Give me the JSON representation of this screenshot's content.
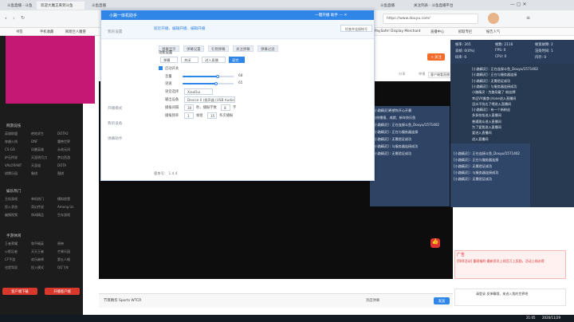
{
  "browser": {
    "tabs": [
      "斗鱼直播 - 斗鱼",
      "欢迎大魔王来到斗鱼",
      "斗鱼直播",
      "斗鱼直播",
      "关注列表 - 斗鱼直播平台"
    ],
    "url": "https://www.douyu.com/",
    "bookmarks": [
      "书签",
      "手机收藏",
      "网易巨人魔兽",
      "百度一下",
      "PaySafe! Display Merchant",
      "直播中心",
      "抓取专栏",
      "报告人气"
    ]
  },
  "leftside": {
    "section_games": "网游竞技",
    "games": [
      "英雄联盟",
      "绝地求生",
      "DOTA2",
      "穿越火线",
      "DNF",
      "魔兽世界",
      "CS:GO",
      "风暴英雄",
      "永劫无间",
      "炉石传说",
      "天涯明月刀",
      "梦幻西游",
      "VALORANT",
      "天涯道",
      "DOTA",
      "棋牌乐园",
      "象棋",
      "围棋"
    ],
    "section_casual": "娱乐热门",
    "casual": [
      "主机游戏",
      "单机热门",
      "模拟经营",
      "投入状态",
      "奇幻传说",
      "Among Us",
      "幽情视频",
      "休闲精品",
      "生存游戏"
    ],
    "section_mobile": "手游休闲",
    "mobile": [
      "王者荣耀",
      "和平精英",
      "原神",
      "火影忍者",
      "天天王者",
      "芒果乐园",
      "CF手游",
      "欢乐麻将",
      "第五人格",
      "也是驾驭",
      "投入模式",
      "QQ飞车"
    ],
    "btn_client": "客户端下载",
    "btn_live": "开播客户端"
  },
  "dialog": {
    "title": "小路一体机助手",
    "title_right": "一键开播 助手 — ✕",
    "banner_text": "就近开播、编辑开播、编辑开播",
    "banner_btn": "检查并连接帐号",
    "nav": [
      "我的设置",
      "开播模式",
      "我的设备",
      "直播信息",
      "弹幕助手"
    ],
    "nav_lower": [
      "私信管理"
    ],
    "top_tabs": [
      "弹幕显示",
      "弹幕设置",
      "礼物弹幕",
      "关注弹幕",
      "弹幕过滤"
    ],
    "section_title": "功能设置",
    "selects": [
      "弹幕",
      "关闭",
      "进入直播",
      "读完"
    ],
    "toggle_label": "启动开关",
    "volume_label": "音量",
    "volume_value": "68",
    "volume_level": 0.68,
    "speed_label": "语速",
    "speed_value": "65",
    "speed_level": 0.65,
    "voice_label": "语音选择",
    "voice_value": "XiaoDui",
    "device_label": "输出设备",
    "device_value": "Device 0 (扬声器 (USB Audio",
    "interval_label": "播报间隔",
    "interval_value": "30",
    "interval_unit": "秒，播报字数",
    "interval_count": "8",
    "interval_end": "字",
    "limit_label": "播报频率",
    "limit_value": "1",
    "limit_unit": "帧组",
    "limit_count": "15",
    "limit_end": "条次播报",
    "version": "版本号： 1.4.4"
  },
  "stats": {
    "rows": [
      [
        "帧率: 265",
        "帧数: 2116",
        "帧宽故障: 2"
      ],
      [
        "丢帧: 0(0%)",
        "FPS: 0",
        "渲染时间: 1"
      ],
      [
        "码率: 0",
        "CPU: 0",
        "内存: 0"
      ]
    ]
  },
  "chat_right": [
    "[小路精灵] : 正在连接斗鱼_Douyu/1571402",
    "[小路精灵] : 正在与服务器连接",
    "[小路精灵] : 无需验证成功",
    "[小路精灵] : 与服务器连接成功",
    "小路精灵 : 为路导戴了 粉丝牌",
    "幸运VX美食小lone进入直播间",
    "泪水不别忘了喂进入直播间",
    "[小路精灵] : 有一个新粉丝",
    "多多恰恰进入直播间",
    "普通观众进入直播间",
    "为了爱我进入直播间",
    "爱进入直播间",
    "进入直播间"
  ],
  "chat_mid": [
    "[小路精灵]希望你开心开最",
    "为你播报、成就、新年快乐鱼",
    "[小路精灵] : 正在连接斗鱼_Douyu/1571402",
    "[小路精灵] : 正在与服务器连接",
    "[小路精灵] : 无需验证成功",
    "[小路精灵] : 与服务器连接成功",
    "[小路精灵] : 无需验证成功"
  ],
  "chat_low": [
    "[小路精灵] : 正在连接斗鱼_Douyu/1571402",
    "[小路精灵] : 正在与服务器连接",
    "[小路精灵] : 无需验证成功",
    "[小路精灵] : 与服务器连接成功",
    "[小路精灵] : 无需验证成功"
  ],
  "page": {
    "follow_btn": "+ 关注",
    "share": "分享",
    "report": "举报",
    "more": "客户端看直播",
    "bottom_left": "节目精华 Sports WTCR",
    "bottom_right_btn": "发送",
    "bottom_mid": "热度弹幕",
    "ad_title": "广告",
    "ad_text": "[拜师活动] 重磅福利·最新资讯上线百万上奖励，活动上线必得",
    "chat_input": "请登录 发弹幕哦，来进入我的世界吧"
  },
  "taskbar": {
    "time": "21:05",
    "date": "2020/11/29"
  }
}
